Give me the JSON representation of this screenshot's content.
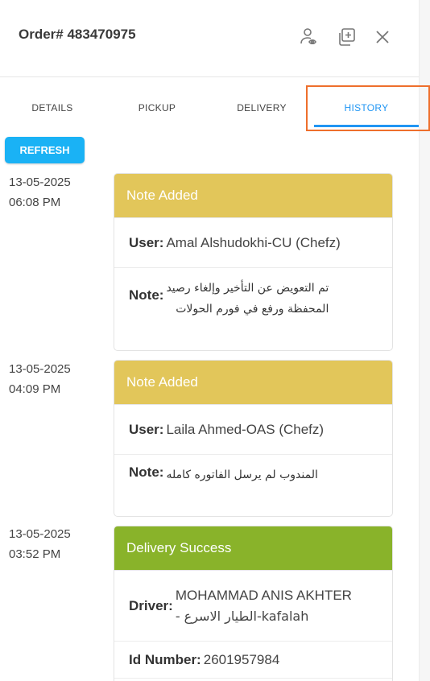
{
  "header": {
    "order_title": "Order# 483470975"
  },
  "tabs": [
    {
      "label": "DETAILS"
    },
    {
      "label": "PICKUP"
    },
    {
      "label": "DELIVERY"
    },
    {
      "label": "HISTORY"
    }
  ],
  "active_tab": "HISTORY",
  "refresh_label": "REFRESH",
  "history": [
    {
      "date": "13-05-2025",
      "time": "06:08 PM",
      "title": "Note Added",
      "user_label": "User:",
      "user_value": "Amal Alshudokhi-CU (Chefz)",
      "note_label": "Note:",
      "note_line1": "تم التعويض عن التأخير وإلغاء رصيد",
      "note_line2": "المحفظة ورفع في فورم الحولات"
    },
    {
      "date": "13-05-2025",
      "time": "04:09 PM",
      "title": "Note Added",
      "user_label": "User:",
      "user_value": "Laila Ahmed-OAS (Chefz)",
      "note_label": "Note:",
      "note_line1": "المندوب لم يرسل الفاتوره كامله"
    },
    {
      "date": "13-05-2025",
      "time": "03:52 PM",
      "title": "Delivery Success",
      "driver_label": "Driver:",
      "driver_line1": "MOHAMMAD ANIS AKHTER",
      "driver_line2": "- الطيار الاسرع-kafalah",
      "id_label": "Id Number:",
      "id_value": "2601957984"
    }
  ],
  "colors": {
    "accent": "#2196f3",
    "refresh": "#1ab2f5",
    "note_header": "#e2c65a",
    "success_header": "#89b32a",
    "highlight": "#ee6f2c"
  },
  "icons": [
    "user-eye-icon",
    "duplicate-icon",
    "close-icon"
  ]
}
